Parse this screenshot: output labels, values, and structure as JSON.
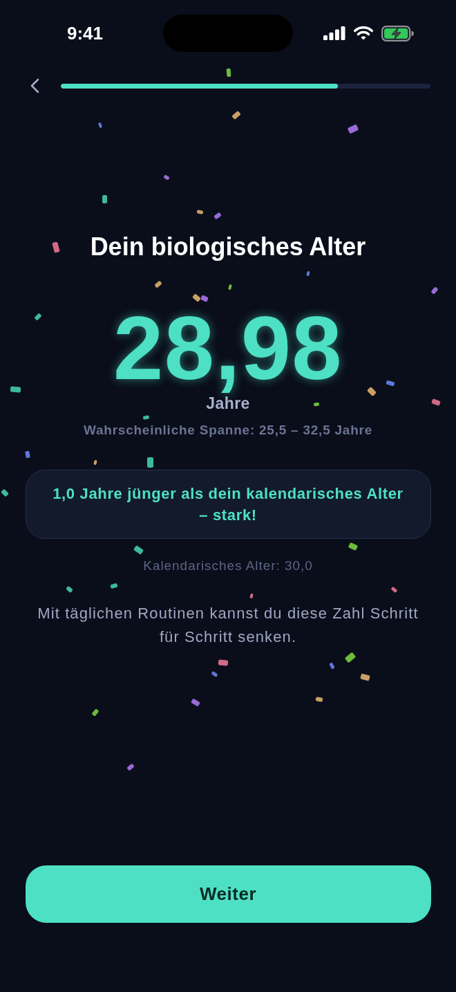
{
  "status_bar": {
    "time": "9:41"
  },
  "header": {
    "progress": {
      "level": 0.75
    }
  },
  "title": "Dein biologisches Alter",
  "result": {
    "value": "28,98",
    "unit": "Jahre",
    "range": "Wahrscheinliche Spanne: 25,5 – 32,5 Jahre"
  },
  "comparison": {
    "text": "1,0 Jahre jünger als dein kalendarisches Alter – stark!"
  },
  "calendar_age": "Kalendarisches Alter: 30,0",
  "hint": "Mit täglichen Routinen kannst du diese Zahl Schritt für Schritt senken.",
  "primary_button": {
    "label": "Weiter"
  }
}
